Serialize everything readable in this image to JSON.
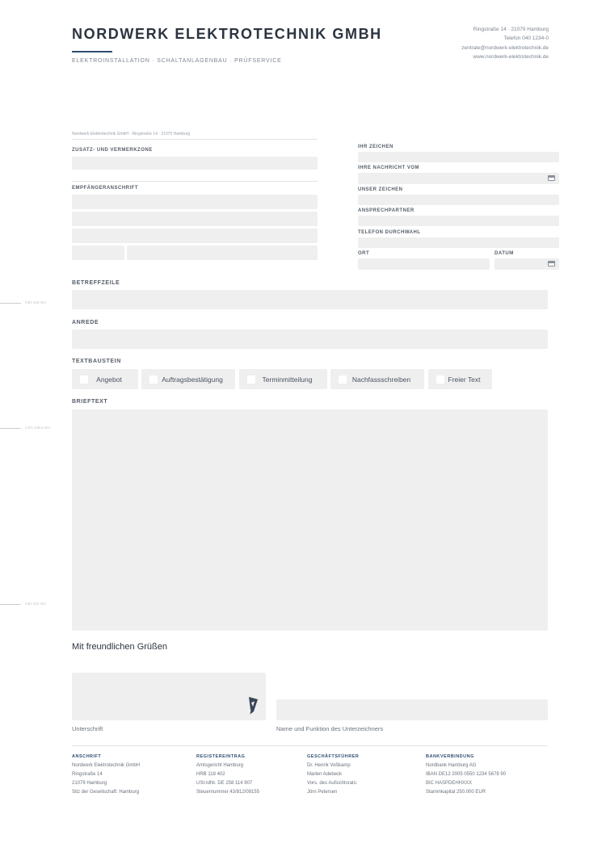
{
  "header": {
    "company": "NORDWERK ELEKTROTECHNIK GMBH",
    "tagline": "ELEKTROINSTALLATION · SCHALTANLAGENBAU · PRÜFSERVICE",
    "contact": [
      "Ringstraße 14 · 21079 Hamburg",
      "Telefon 040 1234-0",
      "zentrale@nordwerk-elektrotechnik.de",
      "www.nordwerk-elektrotechnik.de"
    ]
  },
  "fold_marks": {
    "top": "Falz 105 mm",
    "middle": "Loch 148,5 mm",
    "bottom": "Falz 210 mm"
  },
  "address_block": {
    "return_address": "Nordwerk Elektrotechnik GmbH · Ringstraße 14 · 21079 Hamburg",
    "zusatz_label": "ZUSATZ- UND VERMERKZONE",
    "empfaenger_label": "EMPFÄNGERANSCHRIFT"
  },
  "info_block": {
    "ihr_zeichen": "IHR ZEICHEN",
    "ihre_nachricht": "IHRE NACHRICHT VOM",
    "unser_zeichen": "UNSER ZEICHEN",
    "ansprechpartner": "ANSPRECHPARTNER",
    "telefon": "TELEFON DURCHWAHL",
    "ort": "ORT",
    "datum": "DATUM"
  },
  "letter": {
    "betreff_label": "BETREFFZEILE",
    "anrede_label": "ANREDE",
    "textbaustein_label": "TEXTBAUSTEIN",
    "textbausteine": [
      "Angebot",
      "Auftragsbestätigung",
      "Terminmitteilung",
      "Nachfassschreiben",
      "Freier Text"
    ],
    "brieftext_label": "BRIEFTEXT",
    "greeting": "Mit freundlichen Grüßen",
    "signature_caption": "Unterschrift",
    "signer_caption": "Name und Funktion des Unterzeichners"
  },
  "footer": {
    "anschrift": {
      "title": "ANSCHRIFT",
      "lines": [
        "Nordwerk Elektrotechnik GmbH",
        "Ringstraße 14",
        "21079 Hamburg",
        "Sitz der Gesellschaft: Hamburg"
      ]
    },
    "register": {
      "title": "REGISTEREINTRAG",
      "lines": [
        "Amtsgericht Hamburg",
        "HRB 118 402",
        "USt-IdNr. DE 258 114 907",
        "Steuernummer 43/812/09155"
      ]
    },
    "geschaeftsfuehrer": {
      "title": "GESCHÄFTSFÜHRER",
      "lines": [
        "Dr. Henrik Voßkamp",
        "Marlen Adebeck",
        "Vors. des Aufsichtsrats:",
        "Jörn Petersen"
      ]
    },
    "bank": {
      "title": "BANKVERBINDUNG",
      "lines": [
        "Nordbank Hamburg AG",
        "IBAN DE12 2005 0550 1234 5678 90",
        "BIC HASPDEHHXXX",
        "Stammkapital 250.000 EUR"
      ]
    }
  },
  "icons": {
    "date_picker": "calendar-icon",
    "signature": "pen-nib-icon"
  }
}
